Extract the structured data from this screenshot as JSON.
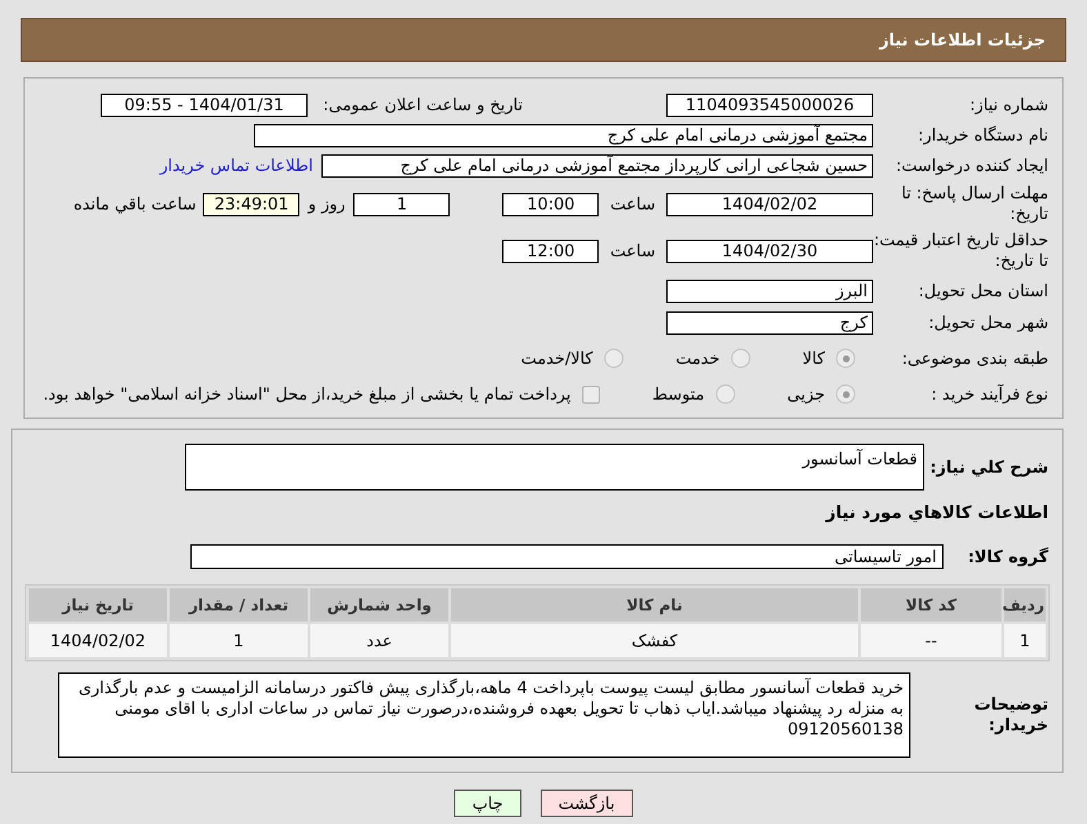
{
  "header": {
    "title": "جزئیات اطلاعات نیاز"
  },
  "need_number": {
    "label": "شماره نیاز:",
    "value": "1104093545000026"
  },
  "announce": {
    "label": "تاریخ و ساعت اعلان عمومی:",
    "value": "1404/01/31 - 09:55"
  },
  "buyer": {
    "label": "نام دستگاه خریدار:",
    "value": "مجتمع آموزشی درمانی امام علی کرج"
  },
  "creator": {
    "label": "ایجاد کننده درخواست:",
    "value": "حسین شجاعی ارانی کارپرداز مجتمع آموزشی درمانی امام علی کرج",
    "link": "اطلاعات تماس خریدار"
  },
  "deadline": {
    "label": "مهلت ارسال پاسخ: تا تاریخ:",
    "date": "1404/02/02",
    "time_label": "ساعت",
    "time": "10:00",
    "days": "1",
    "days_label": "روز و",
    "remaining": "23:49:01",
    "remaining_label": "ساعت باقي مانده"
  },
  "validity": {
    "label": "حداقل تاریخ اعتبار قیمت: تا تاریخ:",
    "date": "1404/02/30",
    "time_label": "ساعت",
    "time": "12:00"
  },
  "province": {
    "label": "استان محل تحویل:",
    "value": "البرز"
  },
  "city": {
    "label": "شهر محل تحویل:",
    "value": "کرج"
  },
  "category": {
    "label": "طبقه بندی موضوعی:",
    "options": [
      {
        "label": "کالا",
        "selected": true
      },
      {
        "label": "خدمت",
        "selected": false
      },
      {
        "label": "کالا/خدمت",
        "selected": false
      }
    ]
  },
  "process": {
    "label": "نوع فرآیند خرید :",
    "options": [
      {
        "label": "جزیی",
        "selected": true
      },
      {
        "label": "متوسط",
        "selected": false
      }
    ],
    "checkbox": {
      "checked": false,
      "label": "پرداخت تمام یا بخشی از مبلغ خرید،از محل \"اسناد خزانه اسلامی\" خواهد بود."
    }
  },
  "description": {
    "label": "شرح کلي نياز:",
    "value": "قطعات آسانسور"
  },
  "goods_heading": "اطلاعات کالاهاي مورد نياز",
  "goods_group": {
    "label": "گروه کالا:",
    "value": "امور تاسیساتی"
  },
  "table": {
    "columns": [
      "ردیف",
      "کد کالا",
      "نام کالا",
      "واحد شمارش",
      "تعداد / مقدار",
      "تاریخ نیاز"
    ],
    "rows": [
      [
        "1",
        "--",
        "کفشک",
        "عدد",
        "1",
        "1404/02/02"
      ]
    ]
  },
  "buyer_notes": {
    "label": "توضیحات خریدار:",
    "value": "خرید قطعات آسانسور مطابق لیست پیوست باپرداخت 4 ماهه،بارگذاری پیش فاکتور درسامانه الزامیست و عدم بارگذاری به منزله رد پیشنهاد میباشد.ایاب ذهاب تا تحویل بعهده فروشنده،درصورت نیاز تماس در ساعات اداری با اقای مومنی 09120560138"
  },
  "buttons": [
    {
      "label": "بازگشت",
      "kind": "back"
    },
    {
      "label": "چاپ",
      "kind": "print"
    }
  ]
}
